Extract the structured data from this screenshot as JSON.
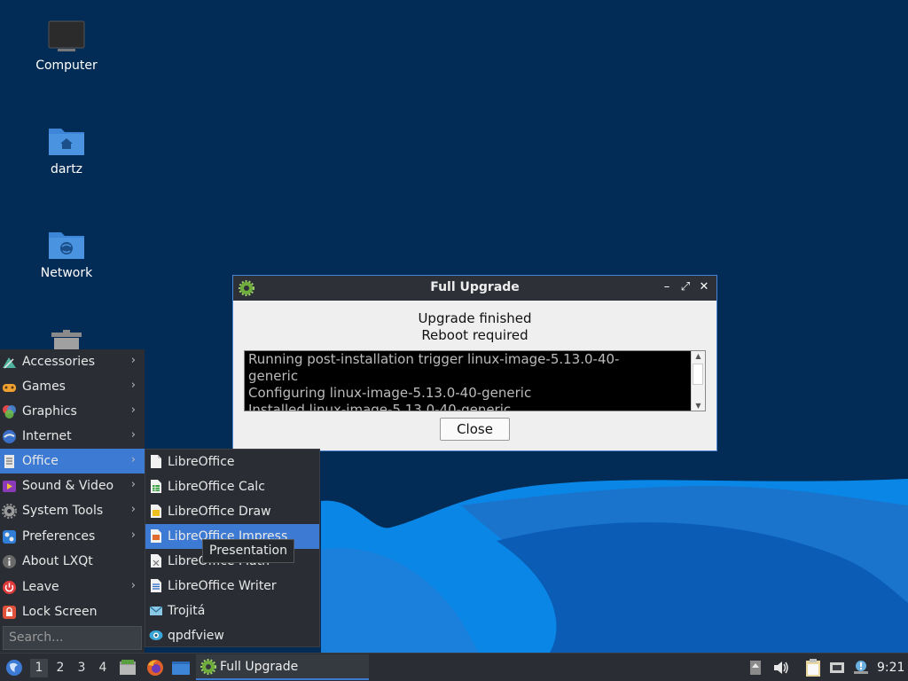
{
  "desktop": {
    "icons": [
      {
        "label": "Computer",
        "icon": "computer-icon"
      },
      {
        "label": "dartz",
        "icon": "home-folder-icon"
      },
      {
        "label": "Network",
        "icon": "network-folder-icon"
      },
      {
        "label": "",
        "icon": "trash-icon"
      }
    ]
  },
  "dialog": {
    "title": "Full Upgrade",
    "line1": "Upgrade finished",
    "line2": "Reboot required",
    "log": [
      "Running post-installation trigger linux-image-5.13.0-40-",
      "generic",
      "Configuring linux-image-5.13.0-40-generic",
      "Installed linux-image-5.13.0-40-generic"
    ],
    "close_label": "Close",
    "minimize_glyph": "–",
    "maximize_glyph": "⤢",
    "close_glyph": "✕"
  },
  "menu": {
    "items": [
      {
        "label": "Accessories",
        "icon": "accessories-icon",
        "arrow": "›"
      },
      {
        "label": "Games",
        "icon": "games-icon",
        "arrow": "›"
      },
      {
        "label": "Graphics",
        "icon": "graphics-icon",
        "arrow": "›"
      },
      {
        "label": "Internet",
        "icon": "internet-icon",
        "arrow": "›"
      },
      {
        "label": "Office",
        "icon": "office-icon",
        "arrow": "›"
      },
      {
        "label": "Sound & Video",
        "icon": "sound-video-icon",
        "arrow": "›"
      },
      {
        "label": "System Tools",
        "icon": "system-tools-icon",
        "arrow": "›"
      },
      {
        "label": "Preferences",
        "icon": "preferences-icon",
        "arrow": "›"
      },
      {
        "label": "About LXQt",
        "icon": "about-icon",
        "arrow": ""
      },
      {
        "label": "Leave",
        "icon": "leave-icon",
        "arrow": "›"
      },
      {
        "label": "Lock Screen",
        "icon": "lock-icon",
        "arrow": ""
      }
    ],
    "search_placeholder": "Search..."
  },
  "submenu": {
    "items": [
      {
        "label": "LibreOffice",
        "icon": "libreoffice-icon"
      },
      {
        "label": "LibreOffice Calc",
        "icon": "libreoffice-calc-icon"
      },
      {
        "label": "LibreOffice Draw",
        "icon": "libreoffice-draw-icon"
      },
      {
        "label": "LibreOffice Impress",
        "icon": "libreoffice-impress-icon"
      },
      {
        "label": "LibreOffice Math",
        "icon": "libreoffice-math-icon"
      },
      {
        "label": "LibreOffice Writer",
        "icon": "libreoffice-writer-icon"
      },
      {
        "label": "Trojitá",
        "icon": "trojita-icon"
      },
      {
        "label": "qpdfview",
        "icon": "qpdfview-icon"
      }
    ]
  },
  "tooltip": "Presentation",
  "taskbar": {
    "workspaces": [
      "1",
      "2",
      "3",
      "4"
    ],
    "task_label": "Full Upgrade",
    "clock": "9:21"
  },
  "colors": {
    "desktop_bg": "#022c55",
    "accent": "#3d7ad4",
    "panel": "#2a2e34"
  }
}
